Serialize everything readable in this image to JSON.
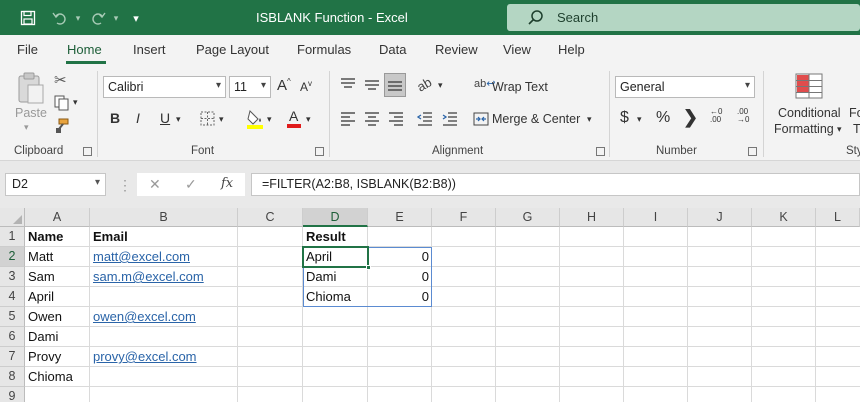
{
  "window": {
    "title": "ISBLANK Function  -  Excel",
    "search_placeholder": "Search"
  },
  "menu": [
    "File",
    "Home",
    "Insert",
    "Page Layout",
    "Formulas",
    "Data",
    "Review",
    "View",
    "Help"
  ],
  "ribbon": {
    "clipboard": {
      "label": "Clipboard",
      "paste": "Paste"
    },
    "font": {
      "label": "Font",
      "family": "Calibri",
      "size": "11",
      "bold": "B",
      "italic": "I",
      "underline": "U"
    },
    "alignment": {
      "label": "Alignment",
      "wrap_text": "Wrap Text",
      "merge_center": "Merge & Center"
    },
    "number": {
      "label": "Number",
      "format": "General"
    },
    "styles": {
      "label": "Styl",
      "conditional_formatting_1": "Conditional",
      "conditional_formatting_2": "Formatting",
      "format_as_1": "Fo",
      "format_as_2": "T"
    }
  },
  "formula_bar": {
    "name_box": "D2",
    "formula": "=FILTER(A2:B8, ISBLANK(B2:B8))"
  },
  "sheet": {
    "columns": [
      "A",
      "B",
      "C",
      "D",
      "E",
      "F",
      "G",
      "H",
      "I",
      "J",
      "K",
      "L"
    ],
    "rows": [
      "1",
      "2",
      "3",
      "4",
      "5",
      "6",
      "7",
      "8",
      "9"
    ],
    "cells": {
      "A1": "Name",
      "B1": "Email",
      "D1": "Result",
      "A2": "Matt",
      "B2": "matt@excel.com",
      "D2": "April",
      "E2": "0",
      "A3": "Sam",
      "B3": "sam.m@excel.com",
      "D3": "Dami",
      "E3": "0",
      "A4": "April",
      "D4": "Chioma",
      "E4": "0",
      "A5": "Owen",
      "B5": "owen@excel.com",
      "A6": "Dami",
      "A7": "Provy",
      "B7": "provy@excel.com",
      "A8": "Chioma"
    }
  },
  "colors": {
    "brand": "#217346",
    "link": "#2a64a8",
    "spill_border": "#5b8bd1"
  }
}
